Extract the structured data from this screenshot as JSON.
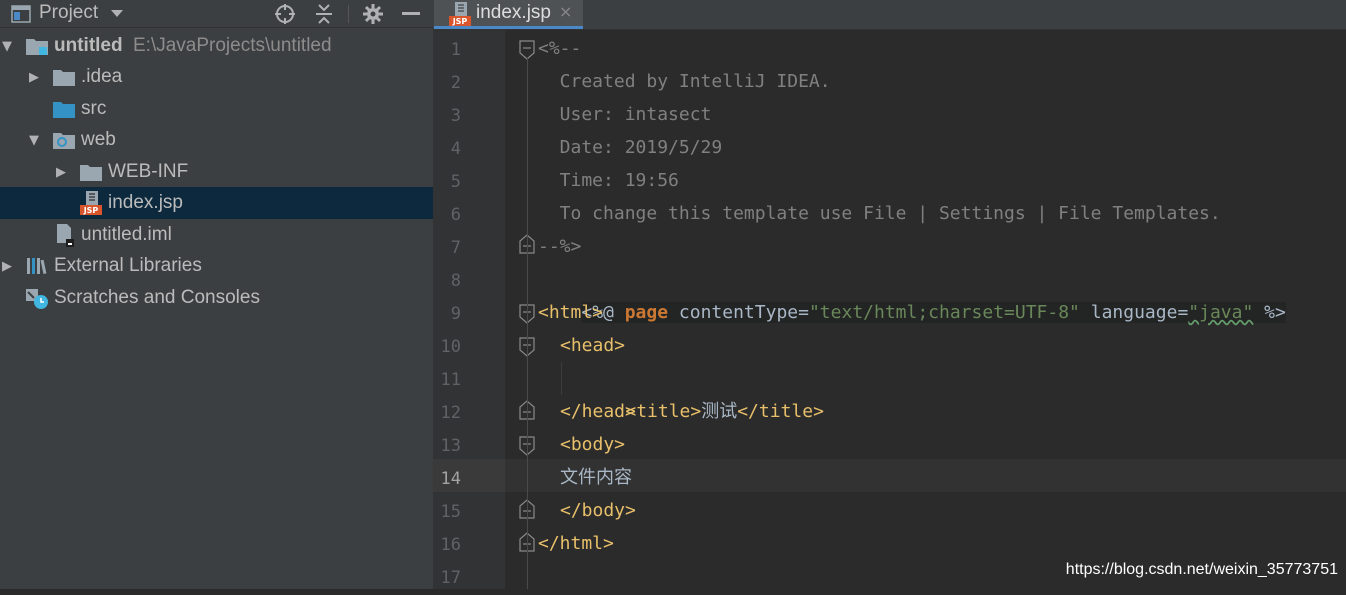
{
  "project_panel": {
    "title": "Project",
    "tree": [
      {
        "label": "untitled",
        "path": "E:\\JavaProjects\\untitled",
        "icon": "module-folder-icon"
      },
      {
        "label": ".idea",
        "icon": "folder-icon"
      },
      {
        "label": "src",
        "icon": "source-folder-icon"
      },
      {
        "label": "web",
        "icon": "web-folder-icon"
      },
      {
        "label": "WEB-INF",
        "icon": "folder-icon"
      },
      {
        "label": "index.jsp",
        "icon": "jsp-file-icon",
        "selected": true
      },
      {
        "label": "untitled.iml",
        "icon": "iml-file-icon"
      },
      {
        "label": "External Libraries",
        "icon": "libraries-icon"
      },
      {
        "label": "Scratches and Consoles",
        "icon": "scratches-icon"
      }
    ]
  },
  "editor": {
    "tab": {
      "label": "index.jsp",
      "close": "×"
    },
    "current_line": 14,
    "line_numbers": [
      "1",
      "2",
      "3",
      "4",
      "5",
      "6",
      "7",
      "8",
      "9",
      "10",
      "11",
      "12",
      "13",
      "14",
      "15",
      "16",
      "17"
    ],
    "lines": {
      "l1": "<%--",
      "l2": "  Created by IntelliJ IDEA.",
      "l3": "  User: intasect",
      "l4": "  Date: 2019/5/29",
      "l5": "  Time: 19:56",
      "l6": "  To change this template use File | Settings | File Templates.",
      "l7": "--%>",
      "l8": {
        "open": "<%@ ",
        "kw": "page",
        "a1": " contentType=",
        "v1": "\"text/html;charset=UTF-8\"",
        "a2": " language=",
        "v2": "\"java\"",
        "close": " %>"
      },
      "l9": "<html>",
      "l10": "<head>",
      "l11": {
        "open": "<title>",
        "text": "测试",
        "close": "</title>"
      },
      "l12": "</head>",
      "l13": "<body>",
      "l14": "文件内容",
      "l15": "</body>",
      "l16": "</html>",
      "l17": ""
    }
  },
  "watermark": "https://blog.csdn.net/weixin_35773751",
  "colors": {
    "panel_bg": "#3c3f41",
    "editor_bg": "#2b2b2b",
    "selection": "#0d293e",
    "tag": "#e8bf6a",
    "keyword": "#cc7832",
    "string": "#6a8759",
    "comment": "#808080",
    "tab_accent": "#4a88c7"
  }
}
